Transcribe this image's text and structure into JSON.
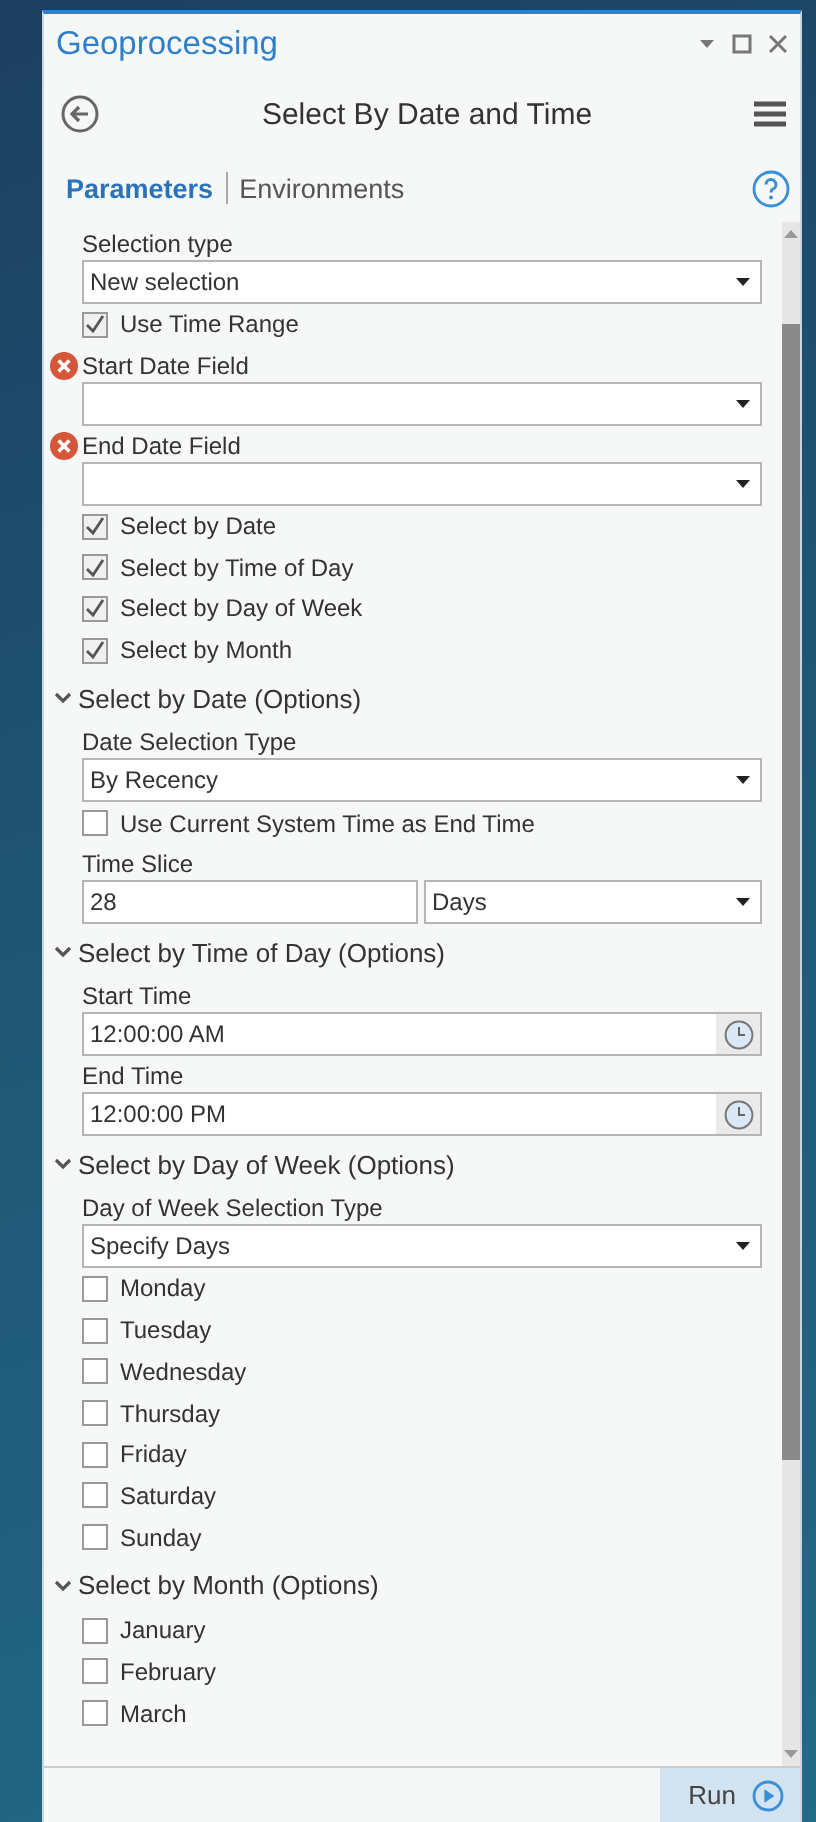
{
  "window": {
    "title": "Geoprocessing"
  },
  "tool": {
    "title": "Select By Date and Time"
  },
  "tabs": [
    {
      "label": "Parameters",
      "selected": true
    },
    {
      "label": "Environments",
      "selected": false
    }
  ],
  "parameters": [
    {
      "kind": "dropdown",
      "label": "Selection type",
      "value": "New selection",
      "error": false
    },
    {
      "kind": "checkbox",
      "label": "Use Time Range",
      "checked": true
    },
    {
      "kind": "dropdown",
      "label": "Start Date Field",
      "error": true
    },
    {
      "kind": "dropdown",
      "label": "End Date Field",
      "error": true
    },
    {
      "kind": "checkbox",
      "label": "Select by Date",
      "checked": true
    },
    {
      "kind": "checkbox",
      "label": "Select by Time of Day",
      "checked": true
    },
    {
      "kind": "checkbox",
      "label": "Select by Day of Week",
      "checked": true
    },
    {
      "kind": "checkbox",
      "label": "Select by Month",
      "checked": true
    },
    {
      "kind": "section",
      "label": "Select by Date (Options)",
      "expanded": true
    },
    {
      "kind": "dropdown",
      "label": "Date Selection Type",
      "value": "By Recency",
      "error": false
    },
    {
      "kind": "checkbox",
      "label": "Use Current System Time as End Time",
      "checked": false
    },
    {
      "kind": "number_unit",
      "label": "Time Slice",
      "value": "28",
      "unit": "Days"
    },
    {
      "kind": "section",
      "label": "Select by Time of Day (Options)",
      "expanded": true
    },
    {
      "kind": "time",
      "label": "Start Time",
      "value": "12:00:00 AM"
    },
    {
      "kind": "time",
      "label": "End Time",
      "value": "12:00:00 PM"
    },
    {
      "kind": "section",
      "label": "Select by Day of Week (Options)",
      "expanded": true
    },
    {
      "kind": "dropdown",
      "label": "Day of Week Selection Type",
      "value": "Specify Days",
      "error": false
    },
    {
      "kind": "checkbox",
      "label": "Monday",
      "checked": false
    },
    {
      "kind": "checkbox",
      "label": "Tuesday",
      "checked": false
    },
    {
      "kind": "checkbox",
      "label": "Wednesday",
      "checked": false
    },
    {
      "kind": "checkbox",
      "label": "Thursday",
      "checked": false
    },
    {
      "kind": "checkbox",
      "label": "Friday",
      "checked": false
    },
    {
      "kind": "checkbox",
      "label": "Saturday",
      "checked": false
    },
    {
      "kind": "checkbox",
      "label": "Sunday",
      "checked": false
    },
    {
      "kind": "section",
      "label": "Select by Month (Options)",
      "expanded": true
    },
    {
      "kind": "checkbox",
      "label": "January",
      "checked": false
    },
    {
      "kind": "checkbox",
      "label": "February",
      "checked": false
    },
    {
      "kind": "checkbox",
      "label": "March",
      "checked": false
    }
  ],
  "run_button": {
    "label": "Run"
  }
}
